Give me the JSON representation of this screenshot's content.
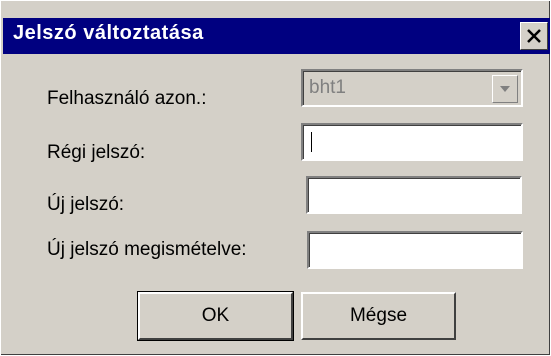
{
  "window": {
    "title": "Jelszó változtatása"
  },
  "labels": {
    "user_id": "Felhasználó azon.:",
    "old_password": "Régi jelszó:",
    "new_password": "Új jelszó:",
    "new_password_repeat": "Új jelszó megismételve:"
  },
  "fields": {
    "user_id_value": "bht1",
    "old_password_value": "",
    "new_password_value": "",
    "new_password_repeat_value": ""
  },
  "buttons": {
    "ok": "OK",
    "cancel": "Mégse"
  },
  "icons": {
    "close": "close-icon",
    "dropdown": "chevron-down-icon"
  },
  "colors": {
    "titlebar": "#000080",
    "dialog_bg": "#d4d0c8"
  }
}
